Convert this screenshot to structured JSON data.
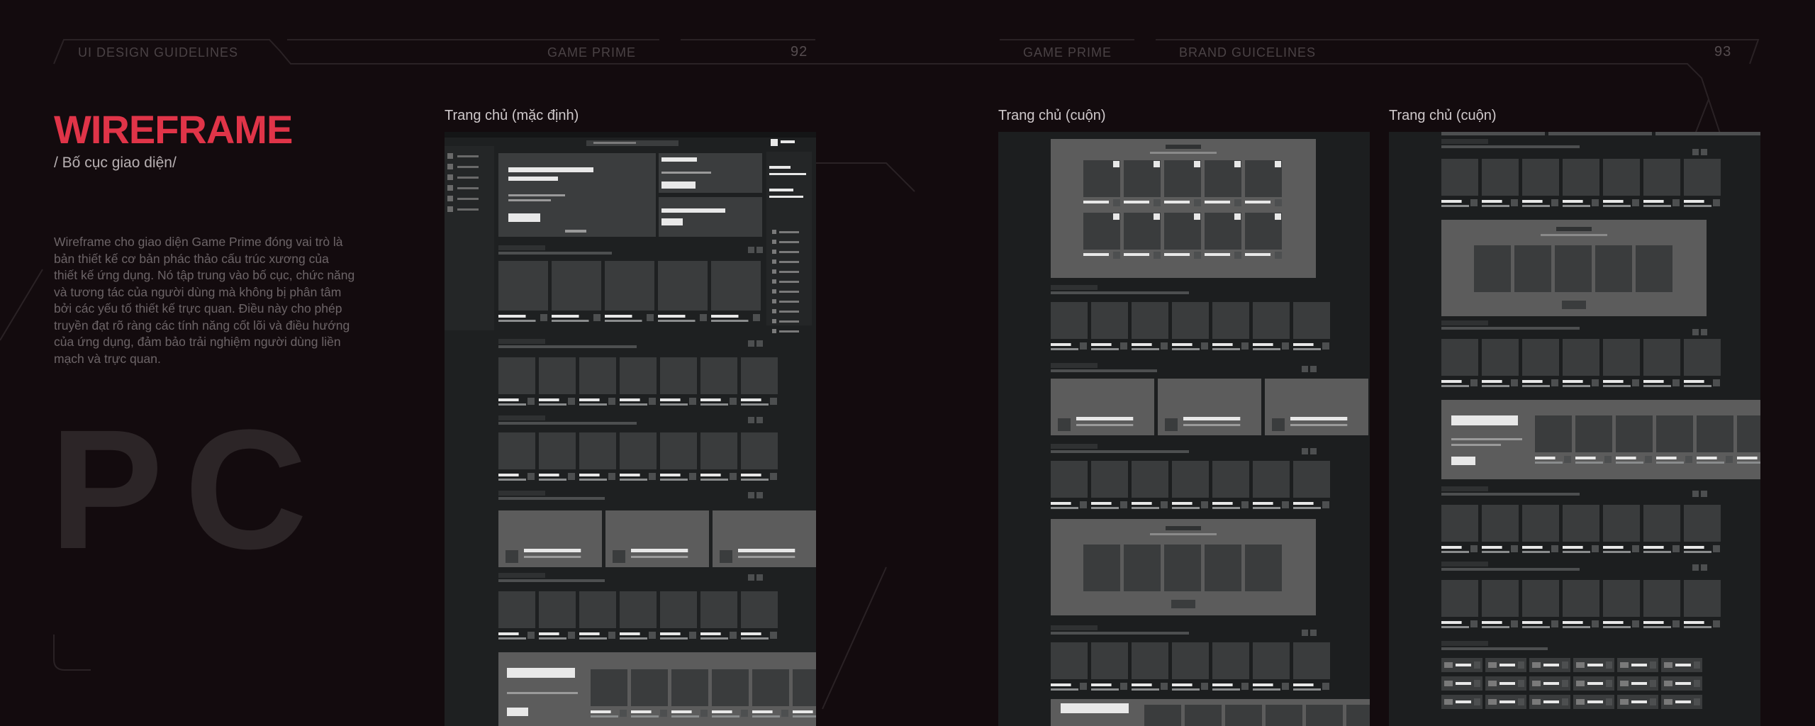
{
  "header": {
    "left_label": "UI DESIGN GUIDELINES",
    "left_brand": "GAME PRIME",
    "left_page": "92",
    "right_brand": "GAME PRIME",
    "right_label": "BRAND GUICELINES",
    "right_page": "93"
  },
  "section": {
    "title": "WIREFRAME",
    "subtitle": "/ Bố cục giao diện/",
    "description": "Wireframe cho giao diện Game Prime đóng vai trò là bản thiết kế cơ bản phác thảo cấu trúc xương của thiết kế ứng dụng. Nó tập trung vào bố cục, chức năng và tương tác của người dùng mà không bị phân tâm bởi các yếu tố thiết kế trực quan. Điều này cho phép truyền đạt rõ ràng các tính năng cốt lõi và điều hướng của ứng dụng, đảm bảo trải nghiệm người dùng liền mạch và trực quan.",
    "platform": "PC"
  },
  "wireframes": [
    {
      "label": "Trang chủ (mặc định)"
    },
    {
      "label": "Trang chủ (cuộn)"
    },
    {
      "label": "Trang chủ (cuộn)"
    }
  ],
  "colors": {
    "background": "#130b0e",
    "accent": "#e03448",
    "frame_bg": "#1c1e1f",
    "panel": "#3a3c3d",
    "highlight_panel": "#5c5c5c",
    "placeholder_text": "#e8e8e8"
  }
}
